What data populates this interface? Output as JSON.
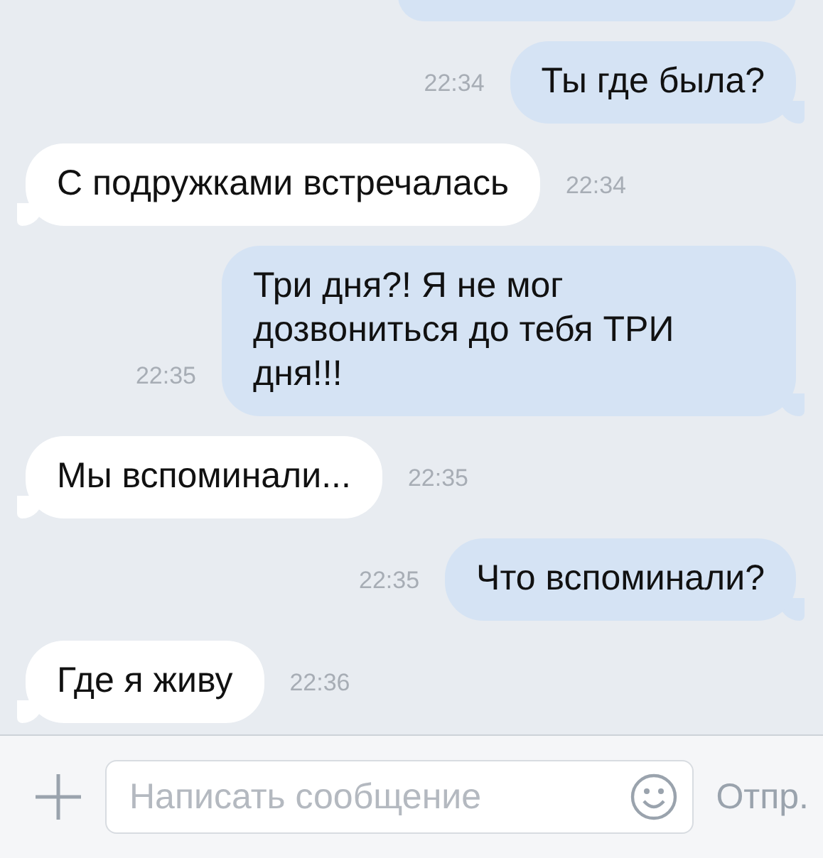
{
  "messages": [
    {
      "text": "Ты где была?",
      "time": "22:34",
      "outgoing": true
    },
    {
      "text": "С подружками встречалась",
      "time": "22:34",
      "outgoing": false
    },
    {
      "text": "Три дня?! Я не мог дозвониться до тебя ТРИ дня!!!",
      "time": "22:35",
      "outgoing": true
    },
    {
      "text": "Мы вспоминали...",
      "time": "22:35",
      "outgoing": false
    },
    {
      "text": "Что вспоминали?",
      "time": "22:35",
      "outgoing": true
    },
    {
      "text": "Где я живу",
      "time": "22:36",
      "outgoing": false
    }
  ],
  "composer": {
    "placeholder": "Написать сообщение",
    "send": "Отпр."
  }
}
